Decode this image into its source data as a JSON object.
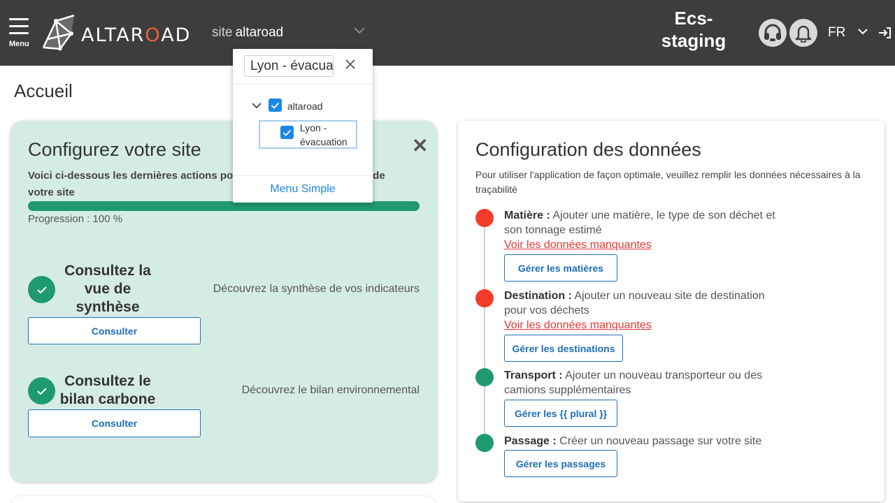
{
  "header": {
    "menu_label": "Menu",
    "logo_text_a": "ALTAR",
    "logo_text_o": "O",
    "logo_text_b": "AD",
    "site_prefix": "site",
    "site_value": "altaroad",
    "environment_line1": "Ecs-",
    "environment_line2": "staging",
    "language": "FR"
  },
  "page": {
    "title": "Accueil"
  },
  "configure_card": {
    "title": "Configurez votre site",
    "intro": "Voici ci-dessous les dernières actions pour terminer la configuration de votre site",
    "progress_label": "Progression : 100 %",
    "progress_percent": 100,
    "steps": [
      {
        "title": "Consultez la vue de synthèse",
        "description": "Découvrez la synthèse de vos indicateurs",
        "button": "Consulter"
      },
      {
        "title": "Consultez le bilan carbone",
        "description": "Découvrez le bilan environnemental",
        "button": "Consulter"
      }
    ]
  },
  "data_card": {
    "title": "Configuration des données",
    "intro": "Pour utiliser l'application de façon optimale, veuillez remplir les données nécessaires à la traçabilité",
    "items": [
      {
        "name": "Matière :",
        "text": " Ajouter une matière, le type de son déchet et son tonnage estimé",
        "status": "missing",
        "missing_link": "Voir les données manquantes",
        "button": "Gérer les matières"
      },
      {
        "name": "Destination :",
        "text": " Ajouter un nouveau site de destination pour vos déchets",
        "status": "missing",
        "missing_link": "Voir les données manquantes",
        "button": "Gérer les destinations"
      },
      {
        "name": "Transport :",
        "text": " Ajouter un nouveau transporteur ou des camions supplémentaires",
        "status": "complete",
        "button": "Gérer les {{ plural }}"
      },
      {
        "name": "Passage :",
        "text": " Créer un nouveau passage sur votre site",
        "status": "complete",
        "button": "Gérer les passages"
      }
    ]
  },
  "site_dropdown": {
    "search_value": "Lyon - évacuation",
    "tree": {
      "root_label": "altaroad",
      "root_checked": true,
      "child_label_line1": "Lyon -",
      "child_label_line2": "évacuation",
      "child_checked": true
    },
    "footer_link": "Menu Simple"
  },
  "colors": {
    "header_bg": "#3d3d3d",
    "accent_green": "#1f9a6e",
    "alert_red": "#f53b2b",
    "link_blue": "#1c6fb8",
    "card_green_bg": "#d5ece4",
    "logo_accent": "#e8603c"
  }
}
